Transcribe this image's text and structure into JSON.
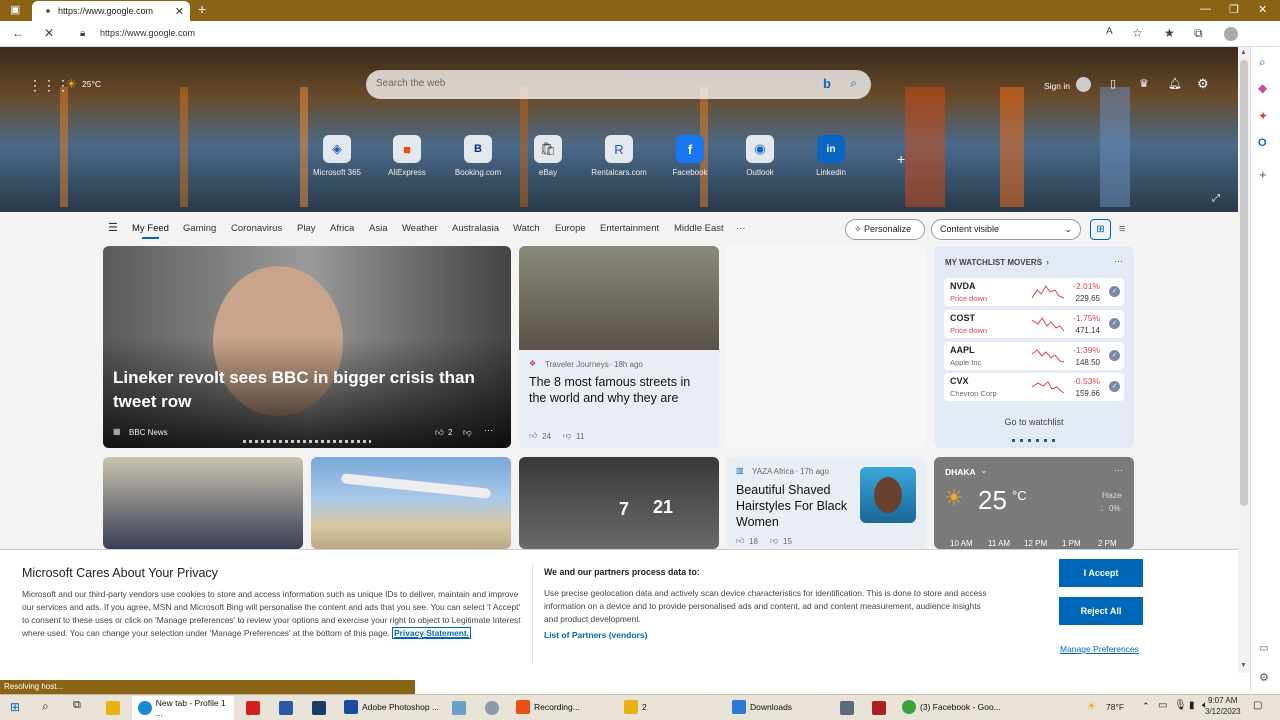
{
  "browser": {
    "tab_title": "https://www.google.com",
    "url": "https://www.google.com",
    "status_text": "Resolving host..."
  },
  "hero": {
    "weather": "25°C",
    "search_placeholder": "Search the web",
    "sign_in": "Sign in",
    "quick_links": [
      "Microsoft 365",
      "AliExpress",
      "Booking.com",
      "eBay",
      "Rentalcars.com",
      "Facebook",
      "Outlook",
      "Linkedin"
    ]
  },
  "feed": {
    "tabs": [
      "My Feed",
      "Gaming",
      "Coronavirus",
      "Play",
      "Africa",
      "Asia",
      "Weather",
      "Australasia",
      "Watch",
      "Europe",
      "Entertainment",
      "Middle East"
    ],
    "more": "···",
    "personalize": "Personalize",
    "content_select": "Content visible"
  },
  "cards": {
    "main": {
      "headline": "Lineker revolt sees BBC in bigger crisis than tweet row",
      "source": "BBC News",
      "likes": "2"
    },
    "second": {
      "source": "Traveler Journeys",
      "time": "18h ago",
      "headline": "The 8 most famous streets in the world and why they are",
      "likes": "24",
      "dislikes": "11"
    },
    "hair": {
      "source": "YAZA Africa",
      "time": "17h ago",
      "headline": "Beautiful Shaved Hairstyles For Black Women",
      "likes": "18",
      "dislikes": "15"
    }
  },
  "watchlist": {
    "title": "MY WATCHLIST MOVERS",
    "stocks": [
      {
        "symbol": "NVDA",
        "sub": "Price down",
        "pct": "-2.01%",
        "price": "229.65"
      },
      {
        "symbol": "COST",
        "sub": "Price down",
        "pct": "-1.75%",
        "price": "471.14"
      },
      {
        "symbol": "AAPL",
        "sub": "Apple Inc",
        "pct": "-1.39%",
        "price": "148.50"
      },
      {
        "symbol": "CVX",
        "sub": "Chevron Corp",
        "pct": "-0.53%",
        "price": "159.66"
      }
    ],
    "button": "Go to watchlist"
  },
  "weather_card": {
    "city": "DHAKA",
    "temp": "25",
    "unit": "°C",
    "condition": "Haze",
    "precip": "0%",
    "hours": [
      "10 AM",
      "11 AM",
      "12 PM",
      "1 PM",
      "2 PM"
    ]
  },
  "privacy": {
    "title": "Microsoft Cares About Your Privacy",
    "body": "Microsoft and our third-party vendors use cookies to store and access information such as unique IDs to deliver, maintain and improve our services and ads. If you agree, MSN and Microsoft Bing will personalise the content and ads that you see. You can select 'I Accept' to consent to these uses or click on 'Manage preferences' to review your options and exercise your right to object to Legitimate Interest where used. You can change your selection under 'Manage Preferences' at the bottom of this page.",
    "privacy_link": "Privacy Statement.",
    "partners_title": "We and our partners process data to:",
    "partners_body": "Use precise geolocation data and actively scan device characteristics for identification. This is done to store and access information on a device and to provide personalised ads and content, ad and content measurement, audience insights and product development.",
    "partners_link": "List of Partners (vendors)",
    "accept": "I Accept",
    "reject": "Reject All",
    "manage": "Manage Preferences"
  },
  "taskbar": {
    "items": [
      "New tab - Profile 1 ...",
      "Adobe Photoshop ...",
      "Recording...",
      "2",
      "Downloads",
      "(3) Facebook - Goo..."
    ],
    "weather": "78°F",
    "time": "9:07 AM",
    "date": "3/12/2023"
  },
  "colors": {
    "accent": "#0067b8",
    "titlebar": "#8a6414",
    "down": "#d44444"
  }
}
